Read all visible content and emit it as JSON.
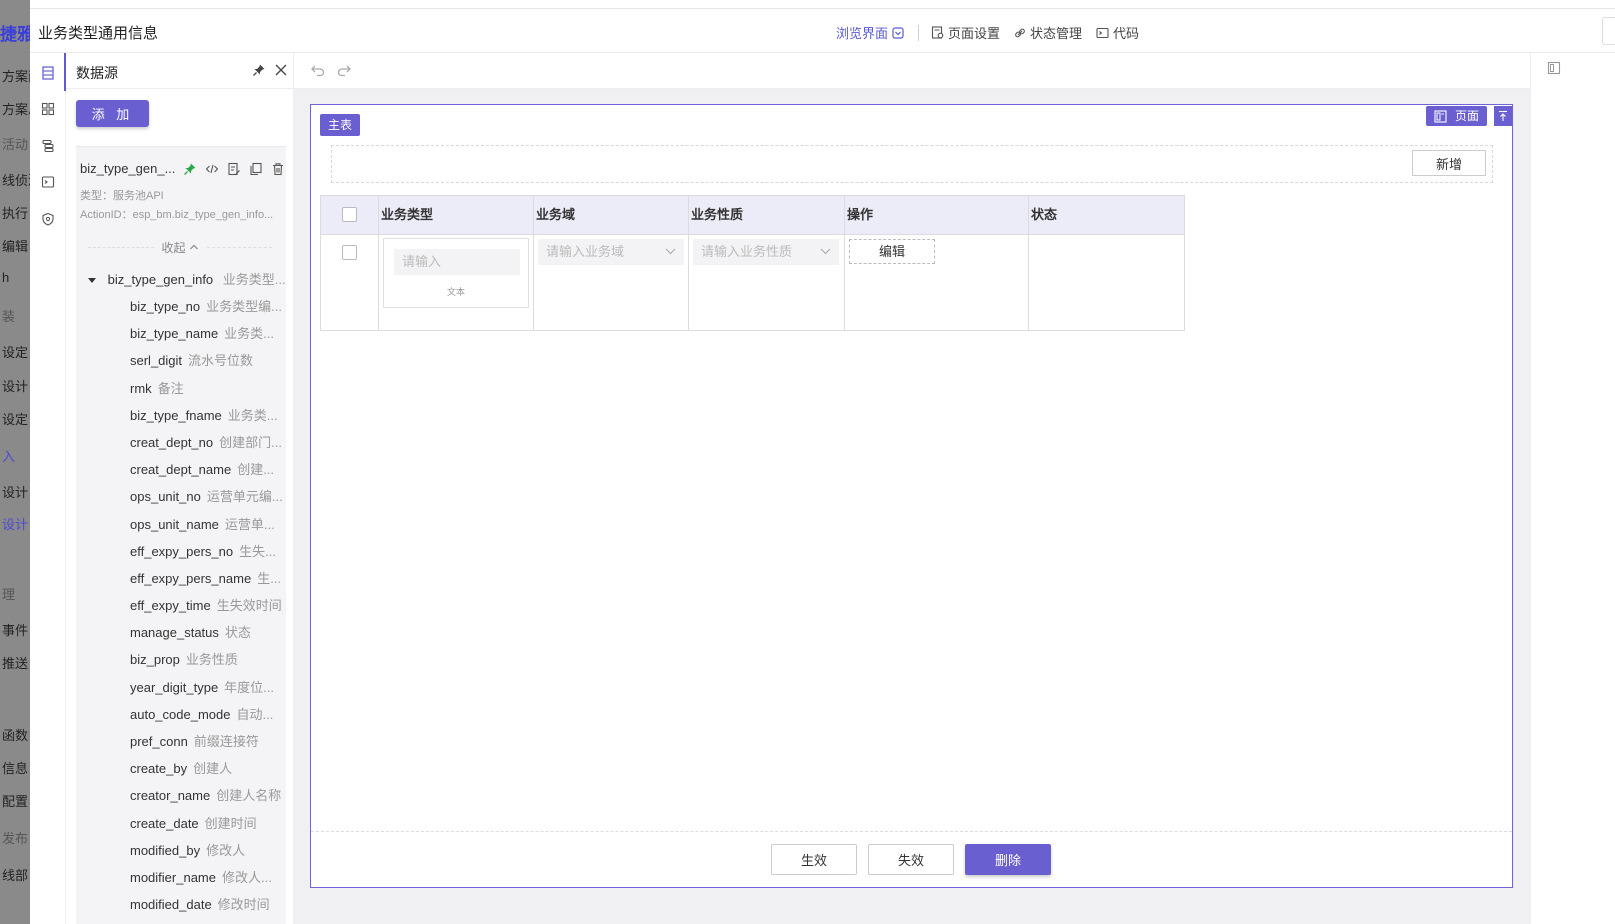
{
  "background_app": {
    "logo": "捷雅",
    "items": [
      {
        "text": "方案面",
        "style": ""
      },
      {
        "text": "方案总",
        "style": ""
      },
      {
        "text": "活动",
        "style": "muted"
      },
      {
        "text": "线侦测",
        "style": ""
      },
      {
        "text": "执行",
        "style": ""
      },
      {
        "text": "编辑",
        "style": ""
      },
      {
        "text": "h",
        "style": ""
      },
      {
        "text": "装",
        "style": "muted"
      },
      {
        "text": "设定",
        "style": ""
      },
      {
        "text": "设计",
        "style": ""
      },
      {
        "text": "设定",
        "style": ""
      },
      {
        "text": "入",
        "style": "blue"
      },
      {
        "text": "设计",
        "style": ""
      },
      {
        "text": "设计",
        "style": "blue"
      },
      {
        "text": "理",
        "style": "muted"
      },
      {
        "text": "事件",
        "style": ""
      },
      {
        "text": "推送",
        "style": ""
      },
      {
        "text": "函数",
        "style": ""
      },
      {
        "text": "信息",
        "style": ""
      },
      {
        "text": "配置",
        "style": ""
      },
      {
        "text": "发布",
        "style": "muted"
      },
      {
        "text": "线部",
        "style": ""
      }
    ]
  },
  "header": {
    "title": "业务类型通用信息",
    "browse_label": "浏览界面",
    "page_settings_label": "页面设置",
    "state_mgmt_label": "状态管理",
    "code_label": "代码"
  },
  "datasource_panel": {
    "title": "数据源",
    "add_label": "添 加",
    "source": {
      "name": "biz_type_gen_...",
      "type_line": "类型：服务池API",
      "action_line": "ActionID：esp_bm.biz_type_gen_info...",
      "collapse_label": "收起"
    },
    "root": {
      "name": "biz_type_gen_info",
      "desc": "业务类型..."
    },
    "fields": [
      {
        "name": "biz_type_no",
        "desc": "业务类型编..."
      },
      {
        "name": "biz_type_name",
        "desc": "业务类..."
      },
      {
        "name": "serl_digit",
        "desc": "流水号位数"
      },
      {
        "name": "rmk",
        "desc": "备注"
      },
      {
        "name": "biz_type_fname",
        "desc": "业务类..."
      },
      {
        "name": "creat_dept_no",
        "desc": "创建部门..."
      },
      {
        "name": "creat_dept_name",
        "desc": "创建..."
      },
      {
        "name": "ops_unit_no",
        "desc": "运营单元编..."
      },
      {
        "name": "ops_unit_name",
        "desc": "运营单..."
      },
      {
        "name": "eff_expy_pers_no",
        "desc": "生失..."
      },
      {
        "name": "eff_expy_pers_name",
        "desc": "生..."
      },
      {
        "name": "eff_expy_time",
        "desc": "生失效时间"
      },
      {
        "name": "manage_status",
        "desc": "状态"
      },
      {
        "name": "biz_prop",
        "desc": "业务性质"
      },
      {
        "name": "year_digit_type",
        "desc": "年度位..."
      },
      {
        "name": "auto_code_mode",
        "desc": "自动..."
      },
      {
        "name": "pref_conn",
        "desc": "前缀连接符"
      },
      {
        "name": "create_by",
        "desc": "创建人"
      },
      {
        "name": "creator_name",
        "desc": "创建人名称"
      },
      {
        "name": "create_date",
        "desc": "创建时间"
      },
      {
        "name": "modified_by",
        "desc": "修改人"
      },
      {
        "name": "modifier_name",
        "desc": "修改人..."
      },
      {
        "name": "modified_date",
        "desc": "修改时间"
      }
    ]
  },
  "designer": {
    "main_tag": "主表",
    "page_tag": "页面",
    "new_label": "新增",
    "columns": [
      "业务类型",
      "业务域",
      "业务性质",
      "操作",
      "状态"
    ],
    "row": {
      "type_placeholder": "请输入",
      "type_caption": "文本",
      "domain_placeholder": "请输入业务域",
      "prop_placeholder": "请输入业务性质",
      "edit_label": "编辑"
    },
    "footer": {
      "activate_label": "生效",
      "deactivate_label": "失效",
      "delete_label": "删除"
    }
  },
  "colors": {
    "accent": "#6a5fd0",
    "link": "#5b5bd6",
    "pin_green": "#2aa84a"
  }
}
